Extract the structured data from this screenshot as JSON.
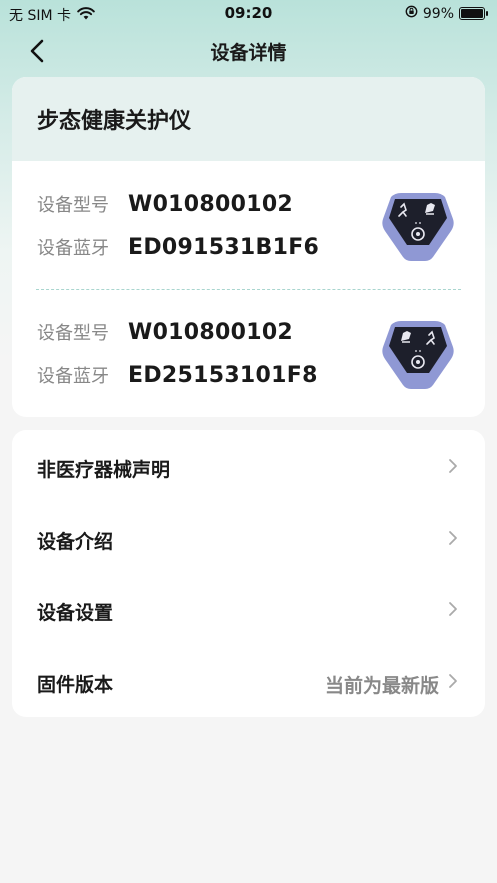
{
  "status_bar": {
    "carrier": "无 SIM 卡",
    "time": "09:20",
    "battery": "99%",
    "battery_level": 0.99,
    "icons": [
      "wifi-icon",
      "orientation-lock-icon",
      "battery-icon"
    ]
  },
  "nav": {
    "title": "设备详情",
    "back_icon": "chevron-left-icon"
  },
  "device": {
    "name": "步态健康关护仪",
    "entries": [
      {
        "model_label": "设备型号",
        "model": "W010800102",
        "bt_label": "设备蓝牙",
        "bt": "ED091531B1F6"
      },
      {
        "model_label": "设备型号",
        "model": "W010800102",
        "bt_label": "设备蓝牙",
        "bt": "ED25153101F8"
      }
    ]
  },
  "menu": {
    "items": [
      {
        "label": "非医疗器械声明",
        "value": ""
      },
      {
        "label": "设备介绍",
        "value": ""
      },
      {
        "label": "设备设置",
        "value": ""
      },
      {
        "label": "固件版本",
        "value": "当前为最新版"
      }
    ]
  },
  "colors": {
    "accent_light": "#b9e2da",
    "card_header": "#e6f1ef",
    "divider": "#a9d6cf",
    "device_body": "#8f98d4",
    "device_face": "#1d1f2b"
  }
}
